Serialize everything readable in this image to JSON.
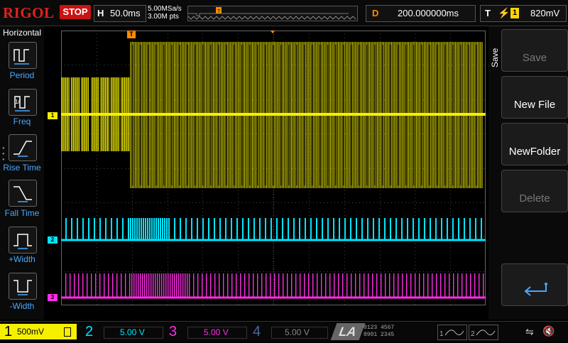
{
  "top": {
    "logo": "RIGOL",
    "run_state": "STOP",
    "h_label": "H",
    "timebase": "50.0ms",
    "sample_rate": "5.00MSa/s",
    "points": "3.00M pts",
    "d_label": "D",
    "delay": "200.000000ms",
    "t_label": "T",
    "trigger_source": "1",
    "trigger_level": "820mV"
  },
  "left_menu": {
    "title": "Horizontal",
    "items": [
      {
        "label": "Period",
        "icon": "period-icon"
      },
      {
        "label": "Freq",
        "icon": "freq-icon"
      },
      {
        "label": "Rise Time",
        "icon": "rise-time-icon"
      },
      {
        "label": "Fall Time",
        "icon": "fall-time-icon"
      },
      {
        "label": "+Width",
        "icon": "positive-width-icon"
      },
      {
        "label": "-Width",
        "icon": "negative-width-icon"
      }
    ]
  },
  "right_menu": {
    "title": "Save",
    "buttons": [
      {
        "label": "Save",
        "enabled": false
      },
      {
        "label": "New File",
        "enabled": true
      },
      {
        "label": "NewFolder",
        "enabled": true
      },
      {
        "label": "Delete",
        "enabled": false
      },
      {
        "label": "",
        "icon": "return-icon",
        "enabled": true
      }
    ]
  },
  "channels": [
    {
      "num": "1",
      "scale": "500mV",
      "color": "#f5f000",
      "marker": "1"
    },
    {
      "num": "2",
      "scale": "5.00 V",
      "color": "#00e5ff",
      "marker": "2"
    },
    {
      "num": "3",
      "scale": "5.00 V",
      "color": "#ff2ee6",
      "marker": "3"
    },
    {
      "num": "4",
      "scale": "5.00 V",
      "color": "#4a6aa0"
    }
  ],
  "bottom": {
    "la_label": "LA",
    "digital_top": "0123 4567",
    "digital_bottom": "8901 2345",
    "icons": [
      "usb-icon",
      "speaker-muted-icon"
    ]
  },
  "colors": {
    "ch1": "#f5f000",
    "ch2": "#00e5ff",
    "ch3": "#ff2ee6",
    "trigger_marker": "#ff8c00",
    "grid": "#4a4a4a"
  }
}
